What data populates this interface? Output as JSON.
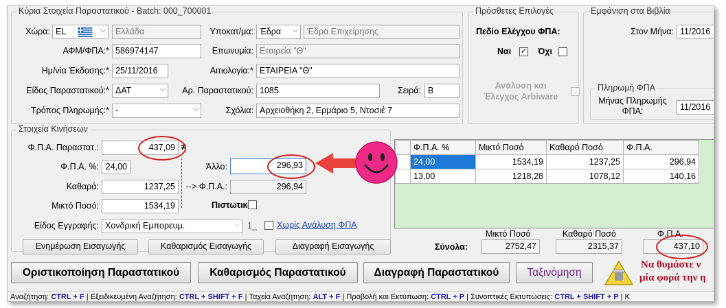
{
  "main": {
    "group_title": "Κύρια Στοιχεία Παραστατικού - Batch: 000_700001",
    "country_label": "Χώρα:",
    "country_code": "EL",
    "country_name": "Ελλάδα",
    "branch_label": "Υποκατ/μα:",
    "branch_value": "Έδρα",
    "branch_desc": "Έδρα Επιχείρησης",
    "afm_label": "ΑΦΜ/ΦΠΑ:*",
    "afm_value": "586974147",
    "company_label": "Επωνυμία:",
    "company_value": "Εταιρεία \"Θ\"",
    "date_label": "Ημ/νία Έκδοσης:*",
    "date_value": "25/11/2016",
    "reason_label": "Αιτιολογία:*",
    "reason_value": "ΕΤΑΙΡΕΙΑ \"Θ\"",
    "doctype_label": "Είδος Παραστατικού:*",
    "doctype_value": "ΔΑΤ",
    "docnum_label": "Αρ. Παραστατικού:",
    "docnum_value": "1085",
    "series_label": "Σειρά:",
    "series_value": "Β",
    "payment_label": "Τρόπος Πληρωμής:*",
    "payment_value": "-",
    "comments_label": "Σχόλια:",
    "comments_value": "Αρχειοθήκη 2, Ερμάριο 5, Ντοσιέ 7"
  },
  "options": {
    "group_title": "Πρόσθετες Επιλογές",
    "vat_check_title": "Πεδίο Ελέγχου ΦΠΑ:",
    "yes_label": "Ναι",
    "yes_mark": "✓",
    "no_label": "Όχι",
    "analysis_label": "Ανάλυση και Έλεγχος Arbiware"
  },
  "books": {
    "group_title": "Εμφάνιση στα Βιβλία",
    "month_label": "Στον Μήνα:",
    "month_value": "11/2016",
    "vat_pay_title": "Πληρωμή ΦΠΑ",
    "vat_month_label": "Μήνας Πληρωμής ΦΠΑ:",
    "vat_month_value": "11/2016"
  },
  "movements": {
    "group_title": "Στοιχεία Κινήσεων",
    "doc_vat_label": "Φ.Π.Α. Παραστατ.:",
    "doc_vat_value": "437,09",
    "doc_vat_marker": "≠",
    "vat_pct_label": "Φ.Π.Α. %:",
    "vat_pct_value": "24,00",
    "net_label": "Καθαρά:",
    "net_value": "1237,25",
    "gross_label": "Μικτό Ποσό:",
    "gross_value": "1534,19",
    "other_label": "Άλλο:",
    "other_value": "296,93",
    "calc_vat_label": "--> Φ.Π.Α.:",
    "calc_vat_value": "296,94",
    "credit_label": "Πιστωτικό",
    "entry_type_label": "Είδος Εγγραφής:",
    "entry_type_value": "Χονδρική Εμπορευμ.",
    "entry_code": "1_",
    "no_vat_link": "Χωρίς Ανάλυση ΦΠΑ",
    "update_button": "Ενημέρωση Εισαγωγής",
    "clear_button": "Καθαρισμός Εισαγωγής",
    "delete_button": "Διαγραφή Εισαγωγής"
  },
  "grid": {
    "headers": [
      "Φ.Π.Α. %",
      "Μικτό Ποσό",
      "Καθαρό Ποσό",
      "Φ.Π.Α."
    ],
    "rows": [
      [
        "24,00",
        "1534,19",
        "1237,25",
        "296,94"
      ],
      [
        "13,00",
        "1218,28",
        "1078,12",
        "140,16"
      ]
    ]
  },
  "totals": {
    "label": "Σύνολα:",
    "gross_header": "Μικτό Ποσό",
    "net_header": "Καθαρό Ποσό",
    "vat_header": "Φ.Π.Α.",
    "gross_value": "2752,47",
    "net_value": "2315,37",
    "vat_value": "437,10"
  },
  "actions": {
    "finalize": "Οριστικοποίηση Παραστατικού",
    "clear": "Καθαρισμός Παραστατικού",
    "delete": "Διαγραφή Παραστατικού",
    "sort": "Ταξινόμηση",
    "sort_color": "#6b1d8c"
  },
  "reminder": {
    "line1": "Να θυμάστε ν",
    "line2": "μία φορά την η",
    "color": "#b0102a"
  },
  "statusbar": {
    "items": [
      {
        "label": "Αναζήτηση:",
        "key": "CTRL + F"
      },
      {
        "label": "Εξειδικευμένη Αναζήτηση:",
        "key": "CTRL + SHIFT + F"
      },
      {
        "label": "Ταχεία Αναζήτηση:",
        "key": "ALT + F"
      },
      {
        "label": "Προβολή και Εκτύπωση:",
        "key": "CTRL + P"
      },
      {
        "label": "Συνοπτικές Εκτυπώσεις:",
        "key": "CTRL + SHIFT + P"
      }
    ],
    "tail": "Κ"
  },
  "annotation": {
    "ring_color": "#d71c1c",
    "arrow_color": "#e8403a",
    "smiley_color": "#ee2a86"
  }
}
